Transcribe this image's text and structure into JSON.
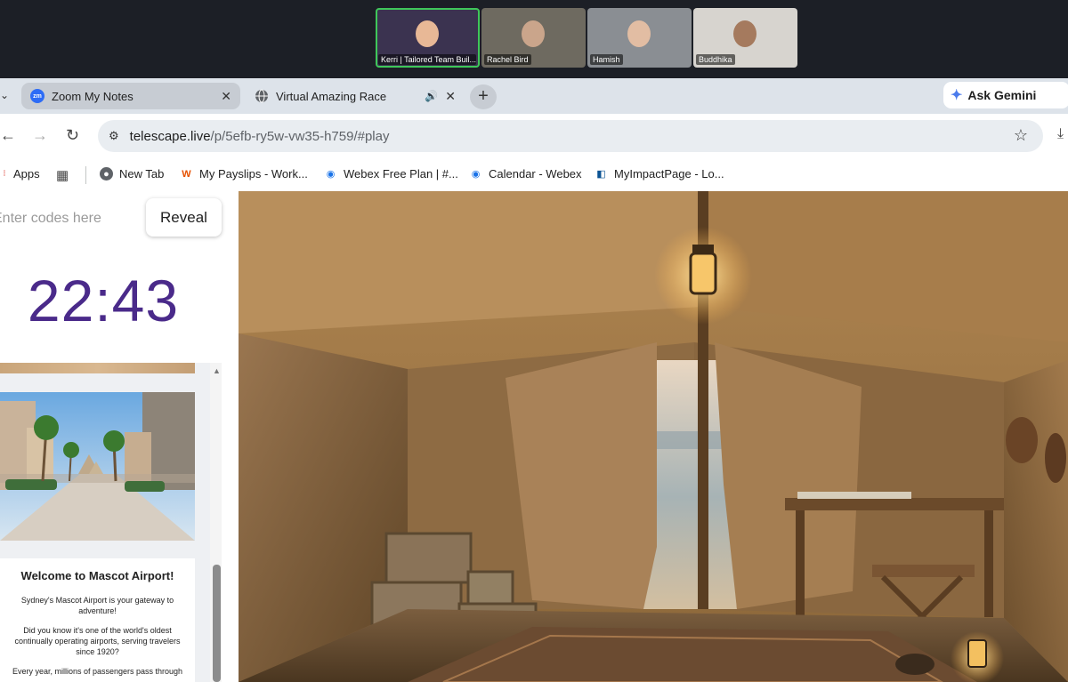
{
  "zoom": {
    "participants": [
      {
        "name": "Kerri | Tailored Team Buil...",
        "bg": "#3b3350",
        "face": "#e8b896",
        "active": true
      },
      {
        "name": "Rachel Bird",
        "bg": "#6e6a60",
        "face": "#caa58b",
        "active": false
      },
      {
        "name": "Hamish",
        "bg": "#8a8e93",
        "face": "#e2bda3",
        "active": false
      },
      {
        "name": "Buddhika",
        "bg": "#d7d4cf",
        "face": "#a57a5e",
        "active": false
      }
    ]
  },
  "browser": {
    "tabs": [
      {
        "label": "Zoom My Notes",
        "favicon": "zm",
        "favicon_color": "#2d6cf6"
      },
      {
        "label": "Virtual Amazing Race",
        "favicon": "globe-icon",
        "favicon_color": "#5f6368"
      }
    ],
    "gemini_label": "Ask Gemini",
    "url_host": "telescape.live",
    "url_path": "/p/5efb-ry5w-vw35-h759/#play",
    "bookmarks": [
      {
        "label": "Apps"
      },
      {
        "label": "New Tab"
      },
      {
        "label": "My Payslips - Work..."
      },
      {
        "label": "Webex Free Plan | #..."
      },
      {
        "label": "Calendar - Webex"
      },
      {
        "label": "MyImpactPage - Lo..."
      }
    ]
  },
  "game": {
    "code_placeholder": "Enter codes here",
    "reveal_label": "Reveal",
    "timer": "22:43",
    "card": {
      "title": "Welcome to Mascot Airport!",
      "paragraphs": [
        "Sydney's Mascot Airport is your gateway to adventure!",
        "Did you know it's one of the world's oldest continually operating airports, serving travelers since 1920?",
        "Every year, millions of passengers pass through"
      ]
    }
  },
  "colors": {
    "timer": "#4a2a8a",
    "accent": "#3fc75a"
  }
}
